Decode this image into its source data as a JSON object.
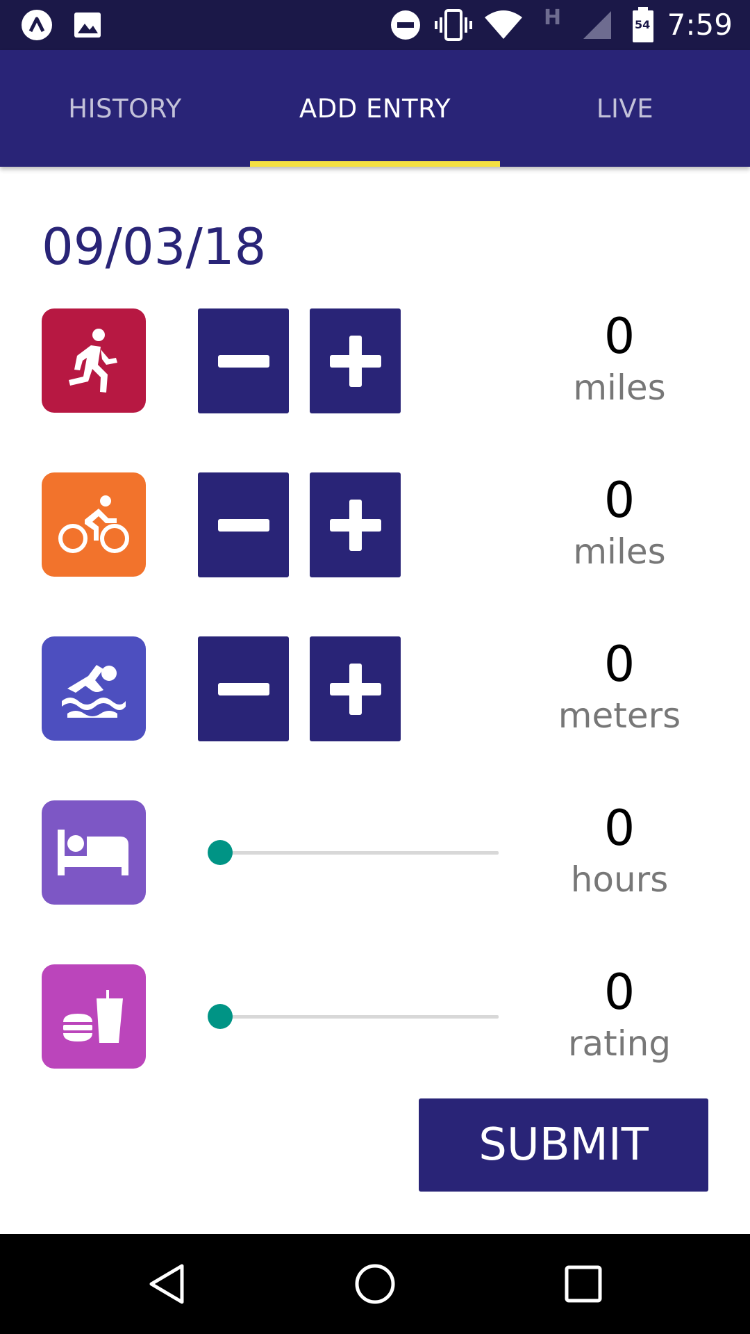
{
  "status_bar": {
    "time": "7:59",
    "network_label": "H",
    "battery_level": "54",
    "icons": [
      "app-notification-icon",
      "image-notification-icon",
      "do-not-disturb-icon",
      "vibrate-icon",
      "wifi-icon",
      "cell-signal-icon",
      "battery-icon"
    ]
  },
  "tabs": [
    {
      "label": "HISTORY",
      "active": false
    },
    {
      "label": "ADD ENTRY",
      "active": true
    },
    {
      "label": "LIVE",
      "active": false
    }
  ],
  "colors": {
    "primary": "#292477",
    "tab_indicator": "#f4e042",
    "slider_accent": "#009485",
    "run": "#b71842",
    "bike": "#f2732c",
    "swim": "#4d4fbf",
    "sleep": "#7d57c5",
    "eat": "#bb45bb"
  },
  "date": "09/03/18",
  "entries": [
    {
      "icon": "running-icon",
      "control": "stepper",
      "value": "0",
      "unit": "miles"
    },
    {
      "icon": "bicycle-icon",
      "control": "stepper",
      "value": "0",
      "unit": "miles"
    },
    {
      "icon": "swimming-icon",
      "control": "stepper",
      "value": "0",
      "unit": "meters"
    },
    {
      "icon": "bed-icon",
      "control": "slider",
      "value": "0",
      "unit": "hours",
      "slider_fraction": 0
    },
    {
      "icon": "food-drink-icon",
      "control": "slider",
      "value": "0",
      "unit": "rating",
      "slider_fraction": 0
    }
  ],
  "submit_label": "SUBMIT",
  "nav_bar": {
    "buttons": [
      "back-icon",
      "home-icon",
      "recents-icon"
    ]
  }
}
